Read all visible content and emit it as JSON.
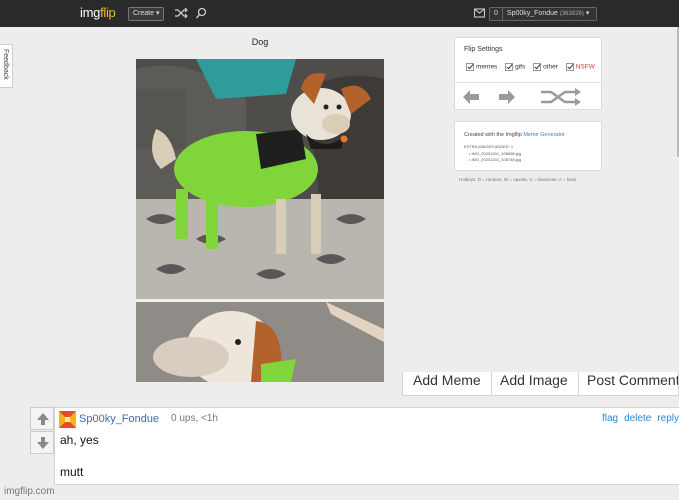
{
  "header": {
    "logo_main": "img",
    "logo_flip": "flip",
    "create_label": "Create ▾",
    "notif_count": "0",
    "username": "Sp00ky_Fondue",
    "points": "(363826)",
    "user_caret": "▾"
  },
  "feedback": {
    "label": "Feedback"
  },
  "meme": {
    "title": "Dog"
  },
  "flip_settings": {
    "title": "Flip Settings",
    "options": [
      "memes",
      "gifs",
      "other",
      "NSFW"
    ]
  },
  "created": {
    "prefix": "Created with the Imgflip",
    "link": "Meme Generator",
    "extra": "EXTRA IMAGES ADDED: 1",
    "files": [
      "• IMG_20201201_105658.jpg",
      "• IMG_20201201_105748.jpg"
    ]
  },
  "hotkeys": "Hotkeys: D = random, W = upvote, S = downvote, A = back",
  "actions": [
    "Add Meme",
    "Add Image",
    "Post Comment"
  ],
  "comment": {
    "user": "Sp00ky_Fondue",
    "meta": "0 ups, <1h",
    "links": [
      "flag",
      "delete",
      "reply"
    ],
    "lines": [
      "ah, yes",
      "mutt"
    ]
  },
  "footer": "imgflip.com",
  "colors": {
    "header_bg": "#2a2a2a",
    "link_blue": "#2a88d8",
    "nsfw_red": "#d43b3b",
    "logo_accent": "#f0b73a"
  },
  "icons": [
    "shuffle-icon",
    "search-icon",
    "mail-icon",
    "arrow-left-icon",
    "arrow-right-icon",
    "upvote-icon",
    "downvote-icon"
  ]
}
